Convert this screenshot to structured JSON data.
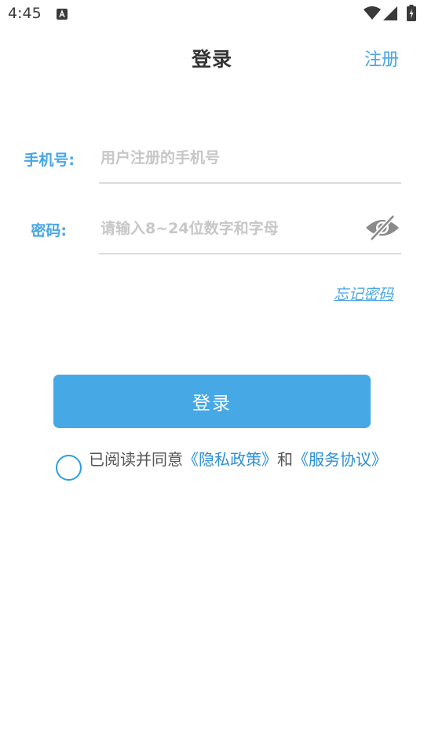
{
  "status_bar": {
    "time": "4:45",
    "notification_icon": "a-notification-icon",
    "wifi_icon": "wifi-icon",
    "signal_icon": "signal-icon",
    "battery_icon": "battery-icon"
  },
  "header": {
    "title": "登录",
    "register_label": "注册"
  },
  "form": {
    "phone": {
      "label": "手机号:",
      "placeholder": "用户注册的手机号",
      "value": ""
    },
    "password": {
      "label": "密码:",
      "placeholder": "请输入8~24位数字和字母",
      "value": "",
      "visibility_icon": "eye-off-icon"
    },
    "forgot_password_label": "忘记密码"
  },
  "login_button_label": "登录",
  "agreement": {
    "checked": false,
    "prefix": "已阅读并同意",
    "privacy_link": "《隐私政策》",
    "conjunction": "和",
    "service_link": "《服务协议》"
  },
  "colors": {
    "accent": "#47a6e4",
    "button": "#47a8e6",
    "link": "#2c8fd6",
    "placeholder": "#c7c7c7",
    "divider": "#dcdcdc"
  }
}
